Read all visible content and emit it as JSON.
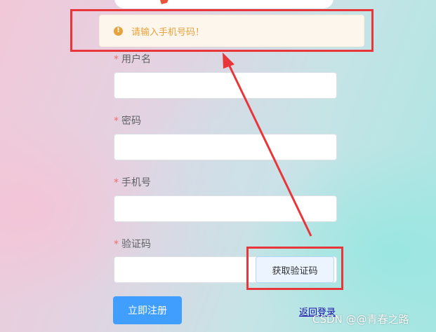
{
  "alert": {
    "icon": "warning-icon",
    "glyph": "!",
    "message": "请输入手机号码！",
    "color": "#e6a23c"
  },
  "form": {
    "required_mark": "*",
    "username": {
      "label": "用户名",
      "value": ""
    },
    "password": {
      "label": "密码",
      "value": ""
    },
    "phone": {
      "label": "手机号",
      "value": ""
    },
    "code": {
      "label": "验证码",
      "value": "",
      "button": "获取验证码"
    }
  },
  "actions": {
    "register": "立即注册",
    "back_to_login": "返回登录"
  },
  "annotations": {
    "highlight_color": "#e8363a"
  },
  "watermark": "CSDN @@青春之路",
  "colors": {
    "primary": "#409eff",
    "danger": "#f56c6c",
    "warning": "#e6a23c"
  }
}
